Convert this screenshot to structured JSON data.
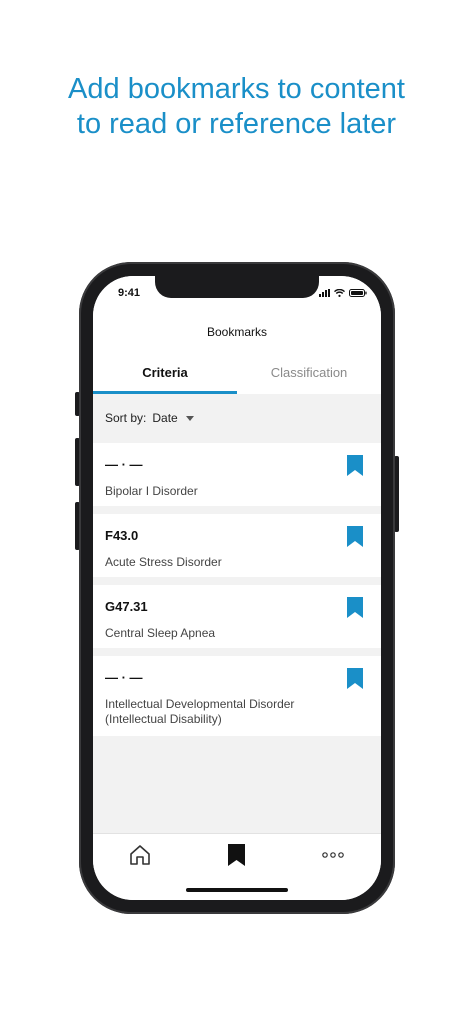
{
  "headline": {
    "line1": "Add bookmarks to content",
    "line2": "to read or reference later"
  },
  "status_bar": {
    "time": "9:41",
    "icons": [
      "signal-icon",
      "wifi-icon",
      "battery-icon"
    ]
  },
  "header": {
    "title": "Bookmarks"
  },
  "tabs": [
    {
      "label": "Criteria",
      "active": true
    },
    {
      "label": "Classification",
      "active": false
    }
  ],
  "sort": {
    "label": "Sort by:",
    "value": "Date"
  },
  "bookmarks": [
    {
      "code": "— · —",
      "title": "Bipolar I Disorder"
    },
    {
      "code": "F43.0",
      "title": "Acute Stress Disorder"
    },
    {
      "code": "G47.31",
      "title": "Central Sleep Apnea"
    },
    {
      "code": "— · —",
      "title_line1": "Intellectual Developmental Disorder",
      "title_line2": "(Intellectual Disability)"
    }
  ],
  "tab_bar": {
    "items": [
      "home-icon",
      "bookmark-icon",
      "more-icon"
    ],
    "active": "bookmark-icon"
  },
  "colors": {
    "accent": "#1a8fc8",
    "background": "#f2f2f2",
    "text": "#111111"
  }
}
